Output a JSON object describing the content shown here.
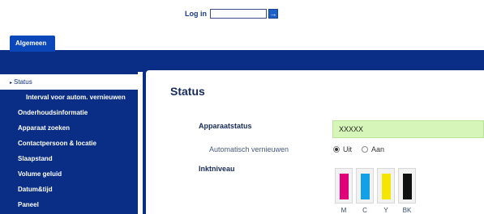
{
  "login": {
    "label": "Log in",
    "value": "",
    "go_icon": "arrow-right-icon"
  },
  "tabs": [
    {
      "label": "Algemeen",
      "active": true
    }
  ],
  "sidebar": {
    "items": [
      {
        "label": "Status",
        "active": true,
        "marker": "▸"
      },
      {
        "label": "Interval voor autom. vernieuwen",
        "sub": true
      },
      {
        "label": "Onderhoudsinformatie"
      },
      {
        "label": "Apparaat zoeken"
      },
      {
        "label": "Contactpersoon & locatie"
      },
      {
        "label": "Slaapstand"
      },
      {
        "label": "Volume geluid"
      },
      {
        "label": "Datum&tijd"
      },
      {
        "label": "Paneel"
      }
    ]
  },
  "main": {
    "title": "Status",
    "device_status_label": "Apparaatstatus",
    "device_status_value": "XXXXX",
    "auto_refresh_label": "Automatisch vernieuwen",
    "auto_refresh_options": [
      {
        "label": "Uit",
        "checked": true
      },
      {
        "label": "Aan",
        "checked": false
      }
    ],
    "ink_label": "Inktniveau",
    "inks": [
      {
        "name": "M",
        "color": "#e0007a",
        "level": 1.0
      },
      {
        "name": "C",
        "color": "#12a0e6",
        "level": 1.0
      },
      {
        "name": "Y",
        "color": "#f5e600",
        "level": 1.0
      },
      {
        "name": "BK",
        "color": "#111111",
        "level": 1.0
      }
    ]
  },
  "colors": {
    "nav": "#0a2e86",
    "tab": "#0b47b8",
    "status_bg": "#d6f5b8"
  }
}
